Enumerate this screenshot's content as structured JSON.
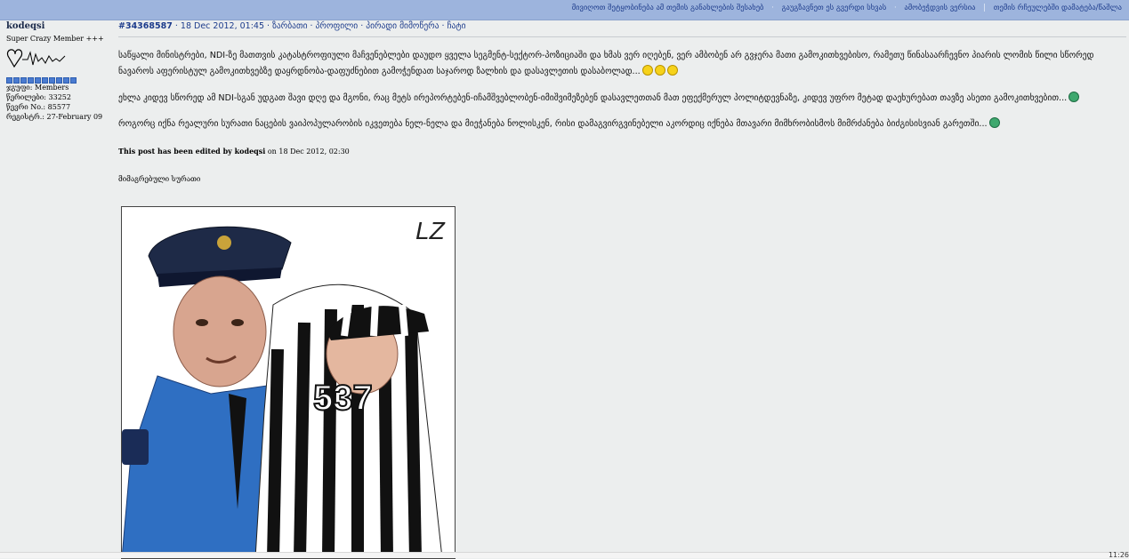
{
  "topbar": {
    "links": [
      "მივიღოთ შეტყობინება ამ თემის განახლების შესახებ",
      "გაუგზავნეთ ეს გვერდი სხვას",
      "ამობეჭდვის ვერსია"
    ],
    "extra": "თემის რჩეულებში დამატება/წაშლა"
  },
  "user": {
    "name": "kodeqsi",
    "rank": "Super Crazy Member +++",
    "group": "ჯგუფი: Members",
    "posts": "წერილები: 33252",
    "member_no": "წევრი No.: 85577",
    "registered": "რეგისტრ.: 27-February 09"
  },
  "post": {
    "id": "#34368587",
    "date": "· 18 Dec 2012, 01:45 ·",
    "actions": "ზარბათი · პროფილი · პირადი მიმოწერა · ჩატი",
    "p1": "საწყალი მინისტრები, NDI-ზე მათთვის კატასტროფიული მაჩვენებლები დაუდო ყველა სეგმენტ-სექტორ-პოზიციაში და ხმას ვერ იღებენ, ვერ ამბობენ არ გვჯერა მათი გამოკითხვებისო, რამეთუ წინასაარჩევნო პიარის ლომის წილი სწორედ ნავაროს აფერისტულ გამოკითხვებზე დაყრდნობა-დაფუძნებით გამოჭენდათ საჯაროდ ზალხის და დასავლეთის დასაბოლად...",
    "p2": "ეხლა კიდევ სწორედ ამ NDI-სგან უდგათ შავი დღე და მგონი, რაც მეტს ირეპორტებენ-იჩამშვებლობენ-იმიშვიმეზებენ დასავლეთთან მათ ეფექმერულ პოლიტდევნაზე, კიდევ უფრო მეტად დაეხურებათ თავზე ასეთი გამოკითხვებით...",
    "p3": "როგორც იქნა რეალური სურათი ნაცების ვაიპოპულარობის იკვეთება ნელ-ნელა და მიეჭანება ნოლისკენ, რისი დამაგვირგვინებელი აკორდიც იქნება მთავარი მიმხრობისმოს მიმრძანება ბიძგისისვიან გარეთში...",
    "edited_prefix": "This post has been edited by ",
    "edited_user": "kodeqsi",
    "edited_suffix": " on 18 Dec 2012, 02:30",
    "attached_label": "მიმაგრებული სურათი",
    "image_logo": "LZ",
    "image_number": "537"
  },
  "status": {
    "clock": "11:26"
  }
}
